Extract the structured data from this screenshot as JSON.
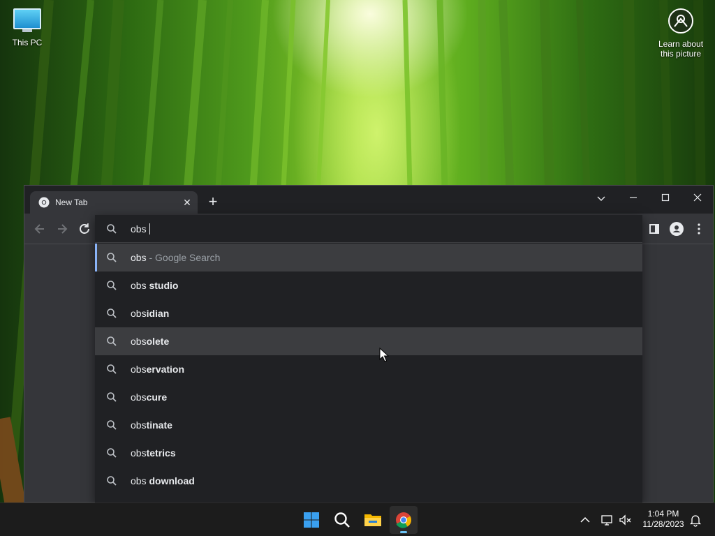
{
  "desktop": {
    "icons": [
      {
        "label": "This PC"
      },
      {
        "label_line1": "Learn about",
        "label_line2": "this picture"
      }
    ]
  },
  "browser": {
    "tab_title": "New Tab",
    "omnibox": {
      "typed_text": "obs",
      "suggestions": [
        {
          "prefix": "obs",
          "bold": "",
          "suffix": " - Google Search"
        },
        {
          "prefix": "obs ",
          "bold": "studio",
          "suffix": ""
        },
        {
          "prefix": "obs",
          "bold": "idian",
          "suffix": ""
        },
        {
          "prefix": "obs",
          "bold": "olete",
          "suffix": ""
        },
        {
          "prefix": "obs",
          "bold": "ervation",
          "suffix": ""
        },
        {
          "prefix": "obs",
          "bold": "cure",
          "suffix": ""
        },
        {
          "prefix": "obs",
          "bold": "tinate",
          "suffix": ""
        },
        {
          "prefix": "obs",
          "bold": "tetrics",
          "suffix": ""
        },
        {
          "prefix": "obs ",
          "bold": "download",
          "suffix": ""
        }
      ]
    },
    "icons": [
      "chrome-icon",
      "close-icon",
      "plus-icon",
      "chevron-down-icon",
      "minimize-icon",
      "maximize-icon",
      "back-icon",
      "forward-icon",
      "reload-icon",
      "search-icon",
      "side-panel-icon",
      "profile-icon",
      "more-icon"
    ]
  },
  "taskbar": {
    "apps": [
      "start-icon",
      "search-icon",
      "file-explorer-icon",
      "chrome-icon"
    ],
    "tray": [
      "chevron-up-icon",
      "network-icon",
      "volume-muted-icon",
      "notification-bell-icon"
    ],
    "time": "1:04 PM",
    "date": "11/28/2023"
  },
  "colors": {
    "accent_blue": "#8ab4f8",
    "dropdown_bg": "#202124",
    "toolbar_bg": "#35363a",
    "selected_row_bg": "#3c3d40",
    "taskbar_bg": "#1c1c1c"
  }
}
